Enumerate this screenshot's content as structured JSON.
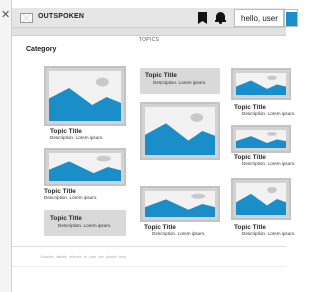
{
  "sidebar": {
    "close_glyph": "✕",
    "close_icon": "close-icon"
  },
  "header": {
    "logo_icon": "image-placeholder-icon",
    "brand": "OUTSPOKEN",
    "bookmark_icon": "bookmark-icon",
    "bell_icon": "bell-icon",
    "user_button": "hello, user",
    "avatar_icon": "avatar-image-icon"
  },
  "tabs": {
    "active": "TOPICS"
  },
  "main": {
    "section_title": "Category",
    "cards": [
      {
        "title": "Topic Title",
        "description": "Description. Lorem ipsum."
      },
      {
        "title": "Topic Title",
        "description": "Description. Lorem ipsum."
      },
      {
        "title": "Topic Title",
        "description": "Description. Lorem ipsum."
      },
      {
        "title": "Topic Title",
        "description": "Description. Lorem ipsum."
      },
      {
        "title": "Topic Title",
        "description": "Description. Lorem ipsum."
      },
      {
        "title": "Topic Title",
        "description": "Description. Lorem ipsum."
      },
      {
        "title": "Topic Title",
        "description": "Description. Lorem ipsum."
      },
      {
        "title": "Topic Title",
        "description": "Description. Lorem ipsum."
      },
      {
        "title": "Topic Title",
        "description": "Description. Lorem ipsum."
      }
    ]
  },
  "footer": {
    "text": "Consider details relevant to user are placed here."
  },
  "colors": {
    "accent": "#1a8ec9",
    "image_frame": "#c4c4c4",
    "card_grey": "#d9d9d9"
  }
}
